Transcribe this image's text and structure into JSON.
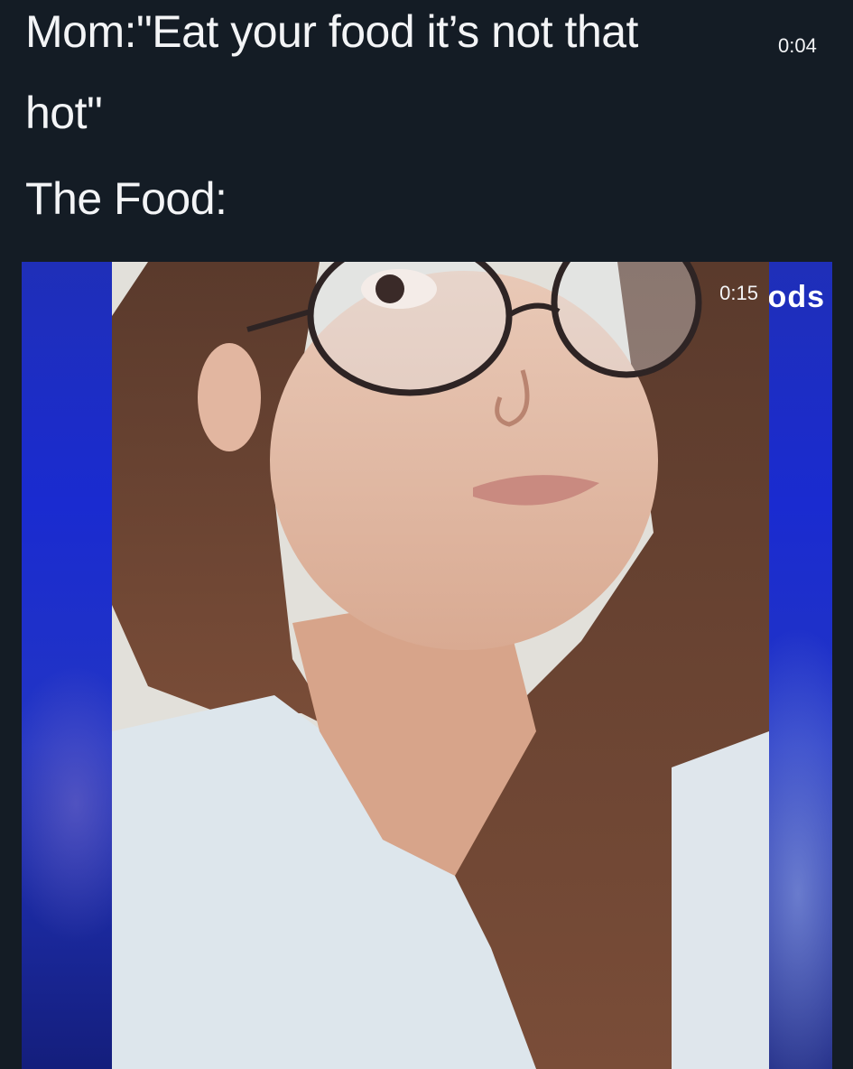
{
  "caption": {
    "line1": "Mom:\"Eat your food it’s not that",
    "line2": "hot\"",
    "line3": "The Food:"
  },
  "timestamps": {
    "top": "0:04",
    "photo": "0:15"
  },
  "background_video": {
    "caption_fragment": "ods"
  },
  "colors": {
    "background": "#141c25",
    "text": "#f3f4f6",
    "video_blue": "#1f2fb8"
  },
  "media": {
    "subject": "selfie-photo"
  }
}
